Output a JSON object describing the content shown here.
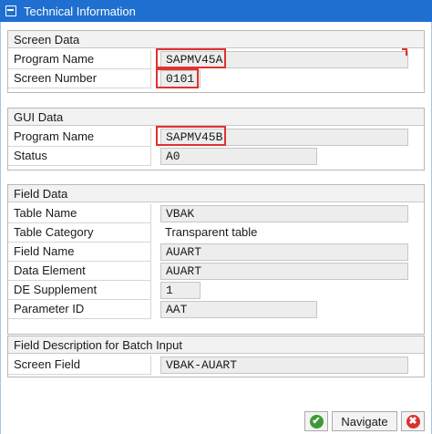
{
  "window": {
    "title": "Technical Information"
  },
  "screen_data": {
    "heading": "Screen Data",
    "program_name_label": "Program Name",
    "program_name_value": "SAPMV45A",
    "screen_number_label": "Screen Number",
    "screen_number_value": "0101"
  },
  "gui_data": {
    "heading": "GUI Data",
    "program_name_label": "Program Name",
    "program_name_value": "SAPMV45B",
    "status_label": "Status",
    "status_value": "A0"
  },
  "field_data": {
    "heading": "Field Data",
    "table_name_label": "Table Name",
    "table_name_value": "VBAK",
    "table_category_label": "Table Category",
    "table_category_value": "Transparent table",
    "field_name_label": "Field Name",
    "field_name_value": "AUART",
    "data_element_label": "Data Element",
    "data_element_value": "AUART",
    "de_supplement_label": "DE Supplement",
    "de_supplement_value": "1",
    "parameter_id_label": "Parameter ID",
    "parameter_id_value": "AAT"
  },
  "batch_input": {
    "heading": "Field Description for Batch Input",
    "screen_field_label": "Screen Field",
    "screen_field_value": "VBAK-AUART"
  },
  "buttons": {
    "ok_glyph": "✔",
    "navigate_label": "Navigate",
    "cancel_glyph": "✖"
  },
  "colors": {
    "titlebar": "#1f6fd0",
    "highlight": "#e0322f",
    "ok": "#3d9a35",
    "cancel": "#d8322c"
  }
}
